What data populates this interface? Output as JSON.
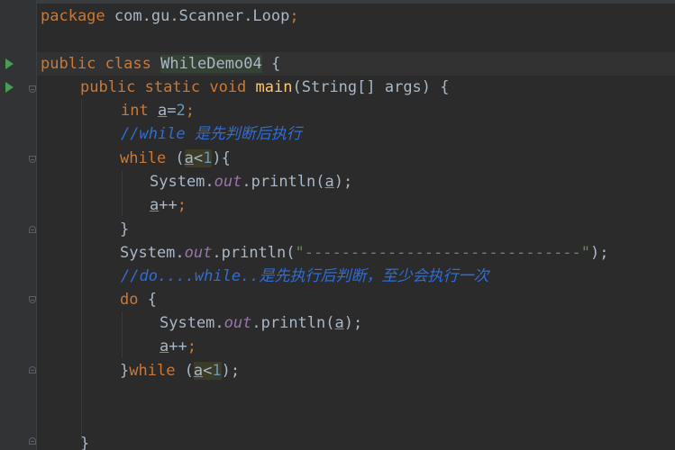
{
  "editor": {
    "language": "java",
    "lines": [
      {
        "package_kw": "package",
        "package_name": "com.gu.Scanner.Loop",
        "semi": ";"
      },
      {},
      {
        "kw1": "public",
        "kw2": "class",
        "class_name": "WhileDemo04",
        "brace": "{"
      },
      {
        "kw1": "public",
        "kw2": "static",
        "kw3": "void",
        "method": "main",
        "params_open": "(String[] args) {"
      },
      {
        "type": "int",
        "var": "a",
        "assign": "=",
        "num": "2",
        "semi": ";"
      },
      {
        "comment": "//while 是先判断后执行"
      },
      {
        "kw": "while",
        "open": " (",
        "var": "a",
        "op": "<",
        "num": "1",
        "close": "){"
      },
      {
        "sys": "System.",
        "field": "out",
        "call": ".println(",
        "var": "a",
        "end": ");"
      },
      {
        "var": "a",
        "op": "++",
        "semi": ";"
      },
      {
        "brace": "}"
      },
      {
        "sys": "System.",
        "field": "out",
        "call": ".println(",
        "str": "\"------------------------------\"",
        "end": ");"
      },
      {
        "comment": "//do....while..是先执行后判断，至少会执行一次"
      },
      {
        "kw": "do",
        "brace": " {"
      },
      {
        "sys": "System.",
        "field": "out",
        "call": ".println(",
        "var": "a",
        "end": ");"
      },
      {
        "var": "a",
        "op": "++",
        "semi": ";"
      },
      {
        "brace_close": "}",
        "kw": "while",
        "open": " (",
        "var": "a",
        "op": "<",
        "num": "1",
        "end": ");"
      },
      {},
      {},
      {
        "brace": "}"
      }
    ]
  },
  "colors": {
    "background": "#2b2b2b",
    "keyword": "#cc7832",
    "method": "#ffc66d",
    "number": "#6897bb",
    "string": "#6a8759",
    "field": "#9876aa",
    "comment": "#2f6dd6",
    "plain": "#a9b7c6",
    "run_icon": "#499c54"
  }
}
